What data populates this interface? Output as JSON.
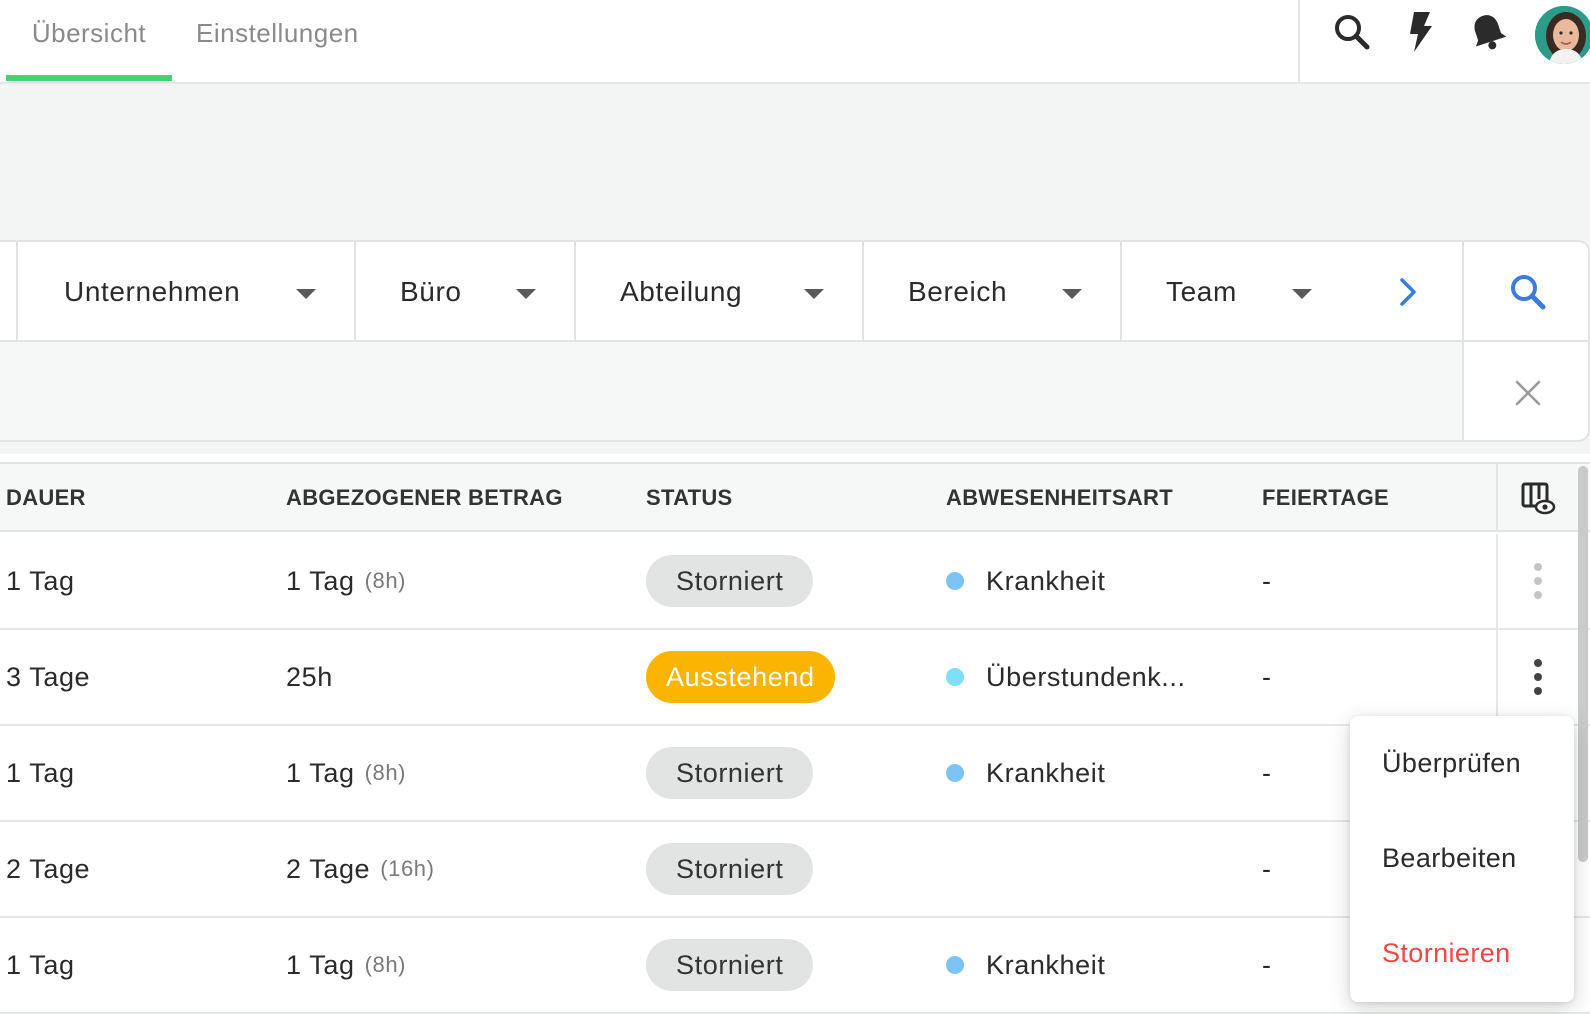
{
  "header": {
    "tabs": [
      {
        "label": "Übersicht",
        "active": true
      },
      {
        "label": "Einstellungen",
        "active": false
      }
    ],
    "icons": [
      "search-icon",
      "lightning-icon",
      "bell-icon",
      "user-avatar"
    ]
  },
  "filters": {
    "items": [
      "Unternehmen",
      "Büro",
      "Abteilung",
      "Bereich",
      "Team"
    ],
    "icons": [
      "chevron-right-icon",
      "search-icon",
      "close-icon"
    ]
  },
  "table": {
    "columns": [
      "DAUER",
      "ABGEZOGENER BETRAG",
      "STATUS",
      "ABWESENHEITSART",
      "FEIERTAGE"
    ],
    "rows": [
      {
        "duration": "1 Tag",
        "amount": "1 Tag",
        "amount_sub": "(8h)",
        "status": "Storniert",
        "status_type": "cancelled",
        "type": "Krankheit",
        "type_color": "#7cc4f5",
        "holidays": "-"
      },
      {
        "duration": "3 Tage",
        "amount": "25h",
        "amount_sub": "",
        "status": "Ausstehend",
        "status_type": "pending",
        "type": "Überstundenk...",
        "type_color": "#7de0f8",
        "holidays": "-"
      },
      {
        "duration": "1 Tag",
        "amount": "1 Tag",
        "amount_sub": "(8h)",
        "status": "Storniert",
        "status_type": "cancelled",
        "type": "Krankheit",
        "type_color": "#7cc4f5",
        "holidays": "-"
      },
      {
        "duration": "2 Tage",
        "amount": "2 Tage",
        "amount_sub": "(16h)",
        "status": "Storniert",
        "status_type": "cancelled",
        "type": "",
        "type_color": "",
        "holidays": "-"
      },
      {
        "duration": "1 Tag",
        "amount": "1 Tag",
        "amount_sub": "(8h)",
        "status": "Storniert",
        "status_type": "cancelled",
        "type": "Krankheit",
        "type_color": "#7cc4f5",
        "holidays": "-"
      }
    ]
  },
  "context_menu": {
    "items": [
      {
        "label": "Überprüfen",
        "color": "#2b2b2b"
      },
      {
        "label": "Bearbeiten",
        "color": "#2b2b2b"
      },
      {
        "label": "Stornieren",
        "color": "#f04747"
      }
    ]
  },
  "colors": {
    "accent_green": "#43d36f",
    "link_blue": "#3b7ddd",
    "pending_yellow": "#fbb400",
    "cancelled_grey": "#e2e3e3",
    "danger_red": "#f04747"
  }
}
